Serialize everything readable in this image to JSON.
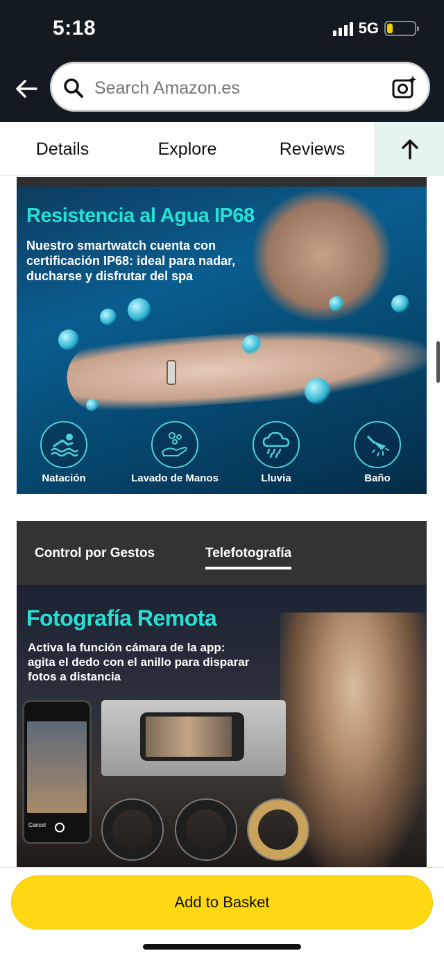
{
  "status_bar": {
    "time": "5:18",
    "network": "5G",
    "battery_level": 0.2
  },
  "search": {
    "placeholder": "Search Amazon.es"
  },
  "tabs": [
    {
      "label": "Details"
    },
    {
      "label": "Explore"
    },
    {
      "label": "Reviews"
    }
  ],
  "product_image_1": {
    "title": "Resistencia al Agua IP68",
    "description": "Nuestro smartwatch cuenta con certificación IP68: ideal para nadar, ducharse y disfrutar del spa",
    "features": [
      {
        "label": "Natación",
        "icon": "swimmer-icon"
      },
      {
        "label": "Lavado de Manos",
        "icon": "hand-wash-icon"
      },
      {
        "label": "Lluvia",
        "icon": "rain-cloud-icon"
      },
      {
        "label": "Baño",
        "icon": "shower-icon"
      }
    ]
  },
  "product_image_2": {
    "tabs": [
      {
        "label": "Control por Gestos"
      },
      {
        "label": "Telefotografía",
        "active": true
      }
    ],
    "title": "Fotografía Remota",
    "description": "Activa la función cámara de la app: agita el dedo con el anillo para disparar fotos a distancia",
    "phone_cancel": "Cancel"
  },
  "bottom": {
    "add_to_basket": "Add to Basket"
  },
  "colors": {
    "header_bg": "#131a22",
    "accent_teal": "#27e0d4",
    "button_yellow": "#ffd814"
  }
}
